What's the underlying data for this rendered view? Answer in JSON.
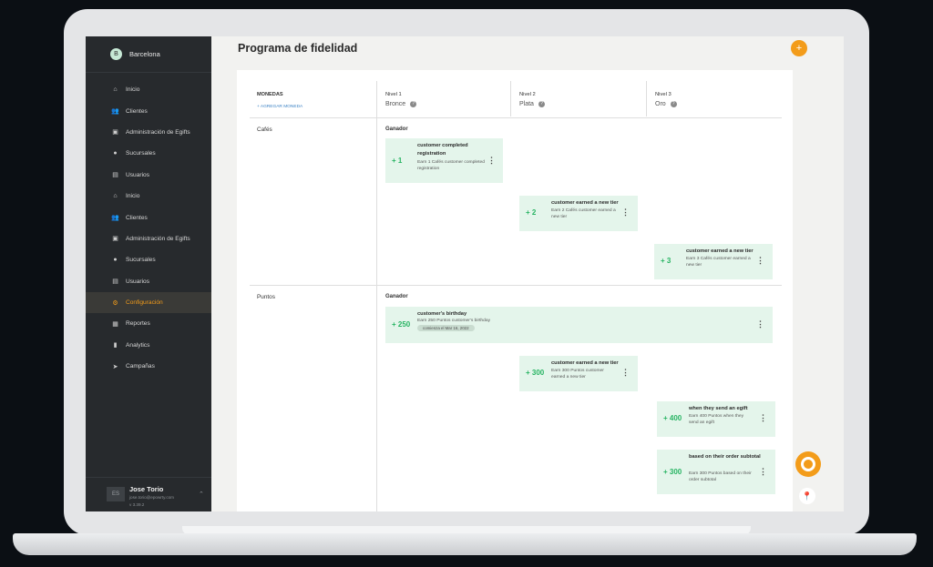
{
  "sidebar": {
    "brand": "Barcelona",
    "brand_initial": "B",
    "items": [
      {
        "label": "Inicio",
        "icon": "home-icon",
        "glyph": "⌂"
      },
      {
        "label": "Clientes",
        "icon": "users-icon",
        "glyph": "👥"
      },
      {
        "label": "Administración de Egifts",
        "icon": "gift-icon",
        "glyph": "▣"
      },
      {
        "label": "Sucursales",
        "icon": "location-pin-icon",
        "glyph": "●"
      },
      {
        "label": "Usuarios",
        "icon": "id-card-icon",
        "glyph": "▤"
      },
      {
        "label": "Inicio",
        "icon": "home-icon",
        "glyph": "⌂"
      },
      {
        "label": "Clientes",
        "icon": "users-icon",
        "glyph": "👥"
      },
      {
        "label": "Administración de Egifts",
        "icon": "gift-icon",
        "glyph": "▣"
      },
      {
        "label": "Sucursales",
        "icon": "location-pin-icon",
        "glyph": "●"
      },
      {
        "label": "Usuarios",
        "icon": "id-card-icon",
        "glyph": "▤"
      },
      {
        "label": "Configuración",
        "icon": "gear-icon",
        "glyph": "⚙",
        "active": true
      },
      {
        "label": "Reportes",
        "icon": "table-icon",
        "glyph": "▦"
      },
      {
        "label": "Analytics",
        "icon": "bar-chart-icon",
        "glyph": "▮"
      },
      {
        "label": "Campañas",
        "icon": "send-icon",
        "glyph": "➤"
      }
    ],
    "user": {
      "name": "Jose Torio",
      "initials": "ES",
      "email": "jose.torio@epowrty.com",
      "version": "v 3.39.2"
    }
  },
  "page": {
    "title": "Programa de fidelidad",
    "add_button": "+"
  },
  "table": {
    "currencies_header": "MONEDAS",
    "add_currency": "+ AGREGAR MONEDA",
    "levels": [
      {
        "name": "Nivel 1",
        "tier": "Bronce"
      },
      {
        "name": "Nivel 2",
        "tier": "Plata"
      },
      {
        "name": "Nivel 3",
        "tier": "Oro"
      }
    ],
    "help_glyph": "?",
    "sections": [
      {
        "currency": "Cafés",
        "winner_label": "Ganador",
        "rules": [
          {
            "points": "+ 1",
            "title": "customer completed registration",
            "desc": "Earn 1 Cafés customer completed registration"
          },
          {
            "points": "+ 2",
            "title": "customer earned a new tier",
            "desc": "Earn 2 Cafés customer earned a new tier"
          },
          {
            "points": "+ 3",
            "title": "customer earned a new tier",
            "desc": "Earn 3 Cafés customer earned a new tier"
          }
        ]
      },
      {
        "currency": "Puntos",
        "winner_label": "Ganador",
        "rules": [
          {
            "points": "+ 250",
            "title": "customer's birthday",
            "desc": "Earn 250 Puntos customer's birthday",
            "tag": "comienza el Mar 16, 2022"
          },
          {
            "points": "+ 300",
            "title": "customer earned a new tier",
            "desc": "Earn 300 Puntos customer earned a new tier"
          },
          {
            "points": "+ 400",
            "title": "when they send an egift",
            "desc": "Earn 400 Puntos when they send an egift"
          },
          {
            "points": "+ 300",
            "title": "based on their order subtotal",
            "desc": "Earn 300 Puntos based on their order subtotal"
          }
        ]
      }
    ],
    "menu_glyph": "⋮"
  },
  "floating": {
    "pin_glyph": "📍"
  },
  "colors": {
    "accent": "#f39c1a",
    "points_green": "#28b463",
    "rule_bg": "#e4f5eb",
    "sidebar_bg": "#272a2d"
  }
}
